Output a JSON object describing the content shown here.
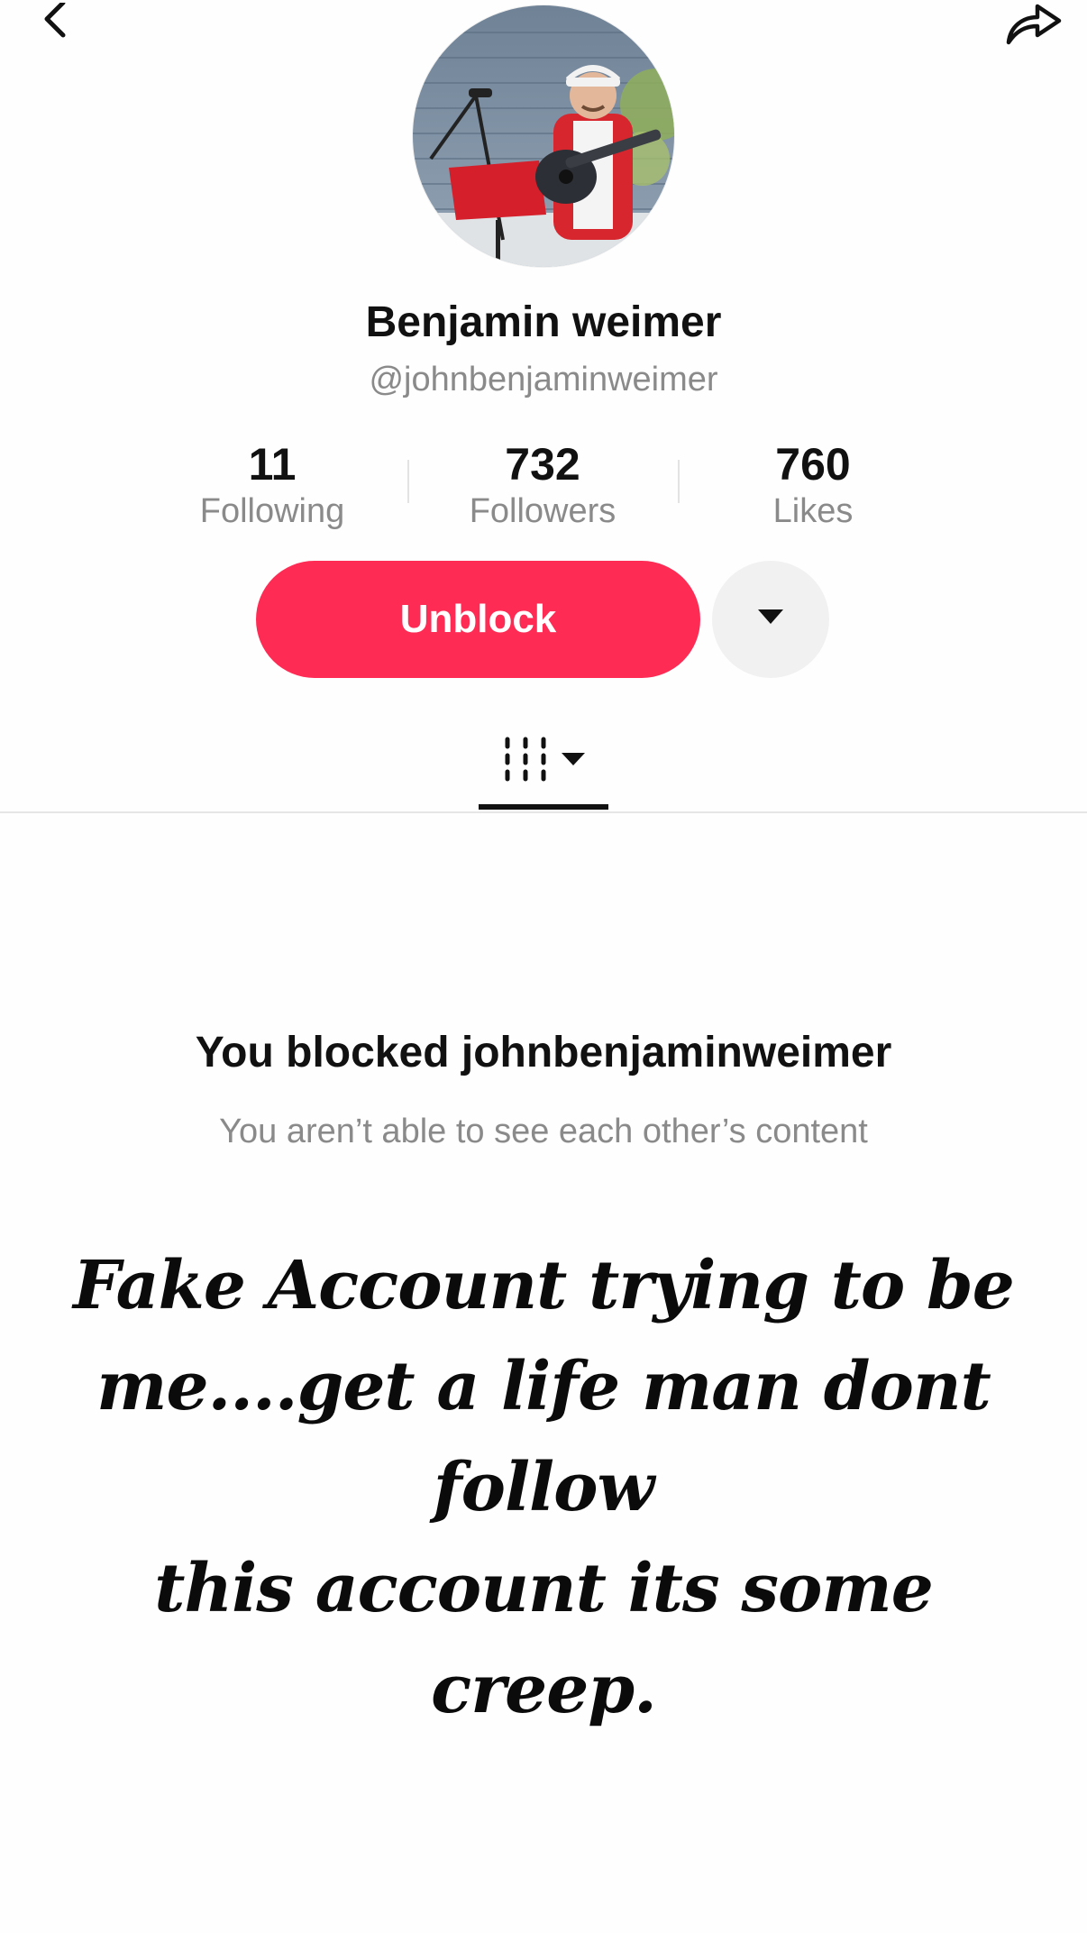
{
  "header": {
    "back_icon": "chevron-left-icon",
    "share_icon": "share-arrow-icon"
  },
  "profile": {
    "display_name": "Benjamin weimer",
    "username": "@johnbenjaminweimer",
    "avatar_description_icon": "avatar-photo"
  },
  "stats": [
    {
      "value": "11",
      "label": "Following"
    },
    {
      "value": "732",
      "label": "Followers"
    },
    {
      "value": "760",
      "label": "Likes"
    }
  ],
  "actions": {
    "unblock_label": "Unblock",
    "more_icon": "caret-down-icon"
  },
  "tabs": {
    "videos_icon": "grid-videos-icon",
    "videos_dropdown_icon": "caret-down-icon"
  },
  "blocked": {
    "title": "You blocked johnbenjaminweimer",
    "subtitle": "You aren’t able to see each other’s content"
  },
  "overlay": {
    "line1": "Fake Account trying to be",
    "line2": "me....get a life man dont follow",
    "line3": "this account its some creep."
  },
  "colors": {
    "accent": "#fe2c55",
    "secondary_button": "#f1f1f2",
    "muted_text": "#8a8a8a"
  }
}
